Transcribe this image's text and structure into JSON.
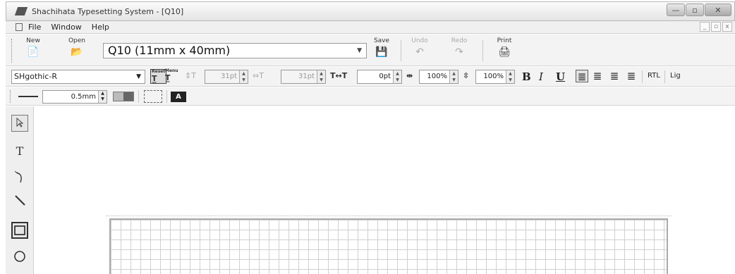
{
  "window": {
    "title": "Shachihata Typesetting System - [Q10]",
    "buttons": {
      "minimize": "—",
      "maximize": "▫",
      "close": "✕"
    }
  },
  "menubar": {
    "items": [
      "File",
      "Window",
      "Help"
    ],
    "mdi_buttons": [
      "_",
      "▫",
      "x"
    ]
  },
  "toolbar": {
    "new": {
      "label": "New",
      "icon": "📄"
    },
    "open": {
      "label": "Open",
      "icon": "📂"
    },
    "size_select": {
      "value": "Q10 (11mm x 40mm)"
    },
    "save": {
      "label": "Save",
      "icon": "💾"
    },
    "undo": {
      "label": "Undo",
      "icon": "↶"
    },
    "redo": {
      "label": "Redo",
      "icon": "↷"
    },
    "print": {
      "label": "Print",
      "icon": "🖨"
    }
  },
  "format_bar": {
    "font": "SHgothic-R",
    "height_value": "31pt",
    "width_value": "31pt",
    "spacing_value": "0pt",
    "scale_h": "100%",
    "scale_v": "100%",
    "bold": "B",
    "italic": "I",
    "underline": "U",
    "rtl": "RTL",
    "lig": "Lig",
    "reset_label": "Reset",
    "menu_label": "Menu"
  },
  "line_bar": {
    "thickness": "0.5mm",
    "fill_label": "A"
  },
  "tools": {
    "select": "select-pointer",
    "text": "T",
    "curve": "curve",
    "line": "line",
    "rectangle": "rectangle",
    "ellipse": "ellipse"
  }
}
